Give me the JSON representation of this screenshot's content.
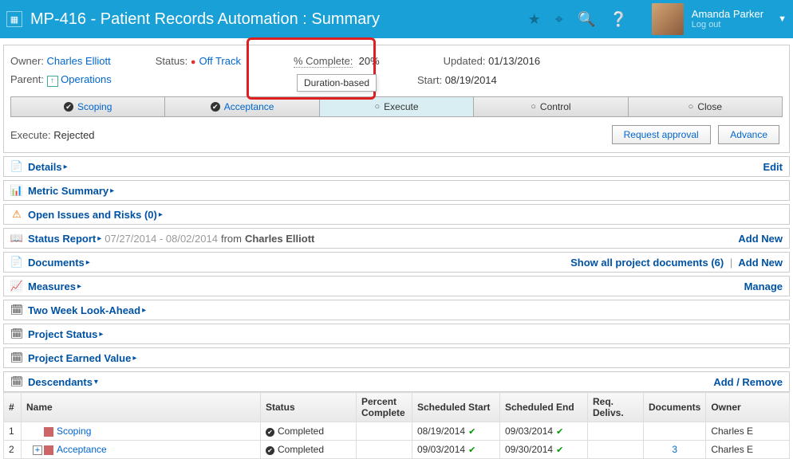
{
  "header": {
    "title": "MP-416 - Patient Records Automation : Summary",
    "user_name": "Amanda Parker",
    "logout": "Log out"
  },
  "info": {
    "owner_lbl": "Owner:",
    "owner": "Charles Elliott",
    "status_lbl": "Status:",
    "status": "Off Track",
    "pct_lbl": "% Complete:",
    "pct": "20%",
    "updated_lbl": "Updated:",
    "updated": "01/13/2016",
    "parent_lbl": "Parent:",
    "parent": "Operations",
    "start_lbl": "Start:",
    "start": "08/19/2014",
    "tooltip": "Duration-based"
  },
  "phases": {
    "scoping": "Scoping",
    "acceptance": "Acceptance",
    "execute": "Execute",
    "control": "Control",
    "close": "Close"
  },
  "exec": {
    "label": "Execute:",
    "value": "Rejected",
    "request": "Request approval",
    "advance": "Advance"
  },
  "sections": {
    "details": "Details",
    "edit": "Edit",
    "metric": "Metric Summary",
    "issues": "Open Issues and Risks (0)",
    "status_report": "Status Report",
    "sr_dates": "07/27/2014 - 08/02/2014",
    "sr_from": "from",
    "sr_author": "Charles Elliott",
    "addnew": "Add New",
    "documents": "Documents",
    "show_docs": "Show all project documents (6)",
    "measures": "Measures",
    "manage": "Manage",
    "twoweek": "Two Week Look-Ahead",
    "proj_status": "Project Status",
    "earned": "Project Earned Value",
    "desc": "Descendants",
    "addremove": "Add / Remove"
  },
  "table": {
    "h_num": "#",
    "h_name": "Name",
    "h_status": "Status",
    "h_pct": "Percent Complete",
    "h_sstart": "Scheduled Start",
    "h_send": "Scheduled End",
    "h_req": "Req. Delivs.",
    "h_docs": "Documents",
    "h_owner": "Owner",
    "rows": [
      {
        "num": "1",
        "name": "Scoping",
        "status": "Completed",
        "sstart": "08/19/2014",
        "send": "09/03/2014",
        "docs": "",
        "owner": "Charles E"
      },
      {
        "num": "2",
        "name": "Acceptance",
        "status": "Completed",
        "sstart": "09/03/2014",
        "send": "09/30/2014",
        "docs": "3",
        "owner": "Charles E"
      }
    ]
  }
}
